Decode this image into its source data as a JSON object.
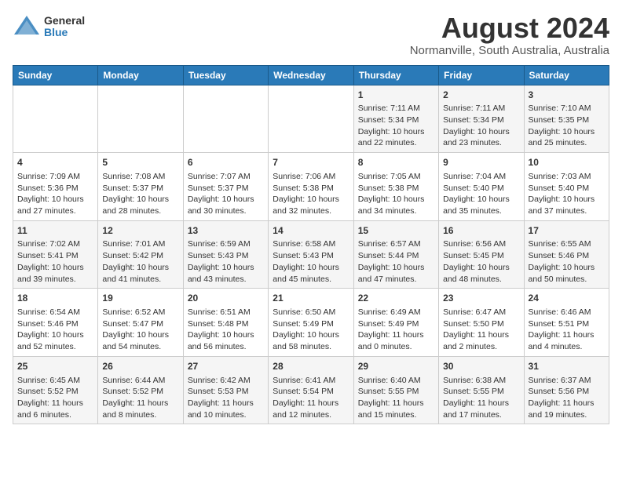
{
  "header": {
    "logo_general": "General",
    "logo_blue": "Blue",
    "month_title": "August 2024",
    "location": "Normanville, South Australia, Australia"
  },
  "days_of_week": [
    "Sunday",
    "Monday",
    "Tuesday",
    "Wednesday",
    "Thursday",
    "Friday",
    "Saturday"
  ],
  "weeks": [
    [
      {
        "day": "",
        "info": ""
      },
      {
        "day": "",
        "info": ""
      },
      {
        "day": "",
        "info": ""
      },
      {
        "day": "",
        "info": ""
      },
      {
        "day": "1",
        "info": "Sunrise: 7:11 AM\nSunset: 5:34 PM\nDaylight: 10 hours\nand 22 minutes."
      },
      {
        "day": "2",
        "info": "Sunrise: 7:11 AM\nSunset: 5:34 PM\nDaylight: 10 hours\nand 23 minutes."
      },
      {
        "day": "3",
        "info": "Sunrise: 7:10 AM\nSunset: 5:35 PM\nDaylight: 10 hours\nand 25 minutes."
      }
    ],
    [
      {
        "day": "4",
        "info": "Sunrise: 7:09 AM\nSunset: 5:36 PM\nDaylight: 10 hours\nand 27 minutes."
      },
      {
        "day": "5",
        "info": "Sunrise: 7:08 AM\nSunset: 5:37 PM\nDaylight: 10 hours\nand 28 minutes."
      },
      {
        "day": "6",
        "info": "Sunrise: 7:07 AM\nSunset: 5:37 PM\nDaylight: 10 hours\nand 30 minutes."
      },
      {
        "day": "7",
        "info": "Sunrise: 7:06 AM\nSunset: 5:38 PM\nDaylight: 10 hours\nand 32 minutes."
      },
      {
        "day": "8",
        "info": "Sunrise: 7:05 AM\nSunset: 5:38 PM\nDaylight: 10 hours\nand 34 minutes."
      },
      {
        "day": "9",
        "info": "Sunrise: 7:04 AM\nSunset: 5:40 PM\nDaylight: 10 hours\nand 35 minutes."
      },
      {
        "day": "10",
        "info": "Sunrise: 7:03 AM\nSunset: 5:40 PM\nDaylight: 10 hours\nand 37 minutes."
      }
    ],
    [
      {
        "day": "11",
        "info": "Sunrise: 7:02 AM\nSunset: 5:41 PM\nDaylight: 10 hours\nand 39 minutes."
      },
      {
        "day": "12",
        "info": "Sunrise: 7:01 AM\nSunset: 5:42 PM\nDaylight: 10 hours\nand 41 minutes."
      },
      {
        "day": "13",
        "info": "Sunrise: 6:59 AM\nSunset: 5:43 PM\nDaylight: 10 hours\nand 43 minutes."
      },
      {
        "day": "14",
        "info": "Sunrise: 6:58 AM\nSunset: 5:43 PM\nDaylight: 10 hours\nand 45 minutes."
      },
      {
        "day": "15",
        "info": "Sunrise: 6:57 AM\nSunset: 5:44 PM\nDaylight: 10 hours\nand 47 minutes."
      },
      {
        "day": "16",
        "info": "Sunrise: 6:56 AM\nSunset: 5:45 PM\nDaylight: 10 hours\nand 48 minutes."
      },
      {
        "day": "17",
        "info": "Sunrise: 6:55 AM\nSunset: 5:46 PM\nDaylight: 10 hours\nand 50 minutes."
      }
    ],
    [
      {
        "day": "18",
        "info": "Sunrise: 6:54 AM\nSunset: 5:46 PM\nDaylight: 10 hours\nand 52 minutes."
      },
      {
        "day": "19",
        "info": "Sunrise: 6:52 AM\nSunset: 5:47 PM\nDaylight: 10 hours\nand 54 minutes."
      },
      {
        "day": "20",
        "info": "Sunrise: 6:51 AM\nSunset: 5:48 PM\nDaylight: 10 hours\nand 56 minutes."
      },
      {
        "day": "21",
        "info": "Sunrise: 6:50 AM\nSunset: 5:49 PM\nDaylight: 10 hours\nand 58 minutes."
      },
      {
        "day": "22",
        "info": "Sunrise: 6:49 AM\nSunset: 5:49 PM\nDaylight: 11 hours\nand 0 minutes."
      },
      {
        "day": "23",
        "info": "Sunrise: 6:47 AM\nSunset: 5:50 PM\nDaylight: 11 hours\nand 2 minutes."
      },
      {
        "day": "24",
        "info": "Sunrise: 6:46 AM\nSunset: 5:51 PM\nDaylight: 11 hours\nand 4 minutes."
      }
    ],
    [
      {
        "day": "25",
        "info": "Sunrise: 6:45 AM\nSunset: 5:52 PM\nDaylight: 11 hours\nand 6 minutes."
      },
      {
        "day": "26",
        "info": "Sunrise: 6:44 AM\nSunset: 5:52 PM\nDaylight: 11 hours\nand 8 minutes."
      },
      {
        "day": "27",
        "info": "Sunrise: 6:42 AM\nSunset: 5:53 PM\nDaylight: 11 hours\nand 10 minutes."
      },
      {
        "day": "28",
        "info": "Sunrise: 6:41 AM\nSunset: 5:54 PM\nDaylight: 11 hours\nand 12 minutes."
      },
      {
        "day": "29",
        "info": "Sunrise: 6:40 AM\nSunset: 5:55 PM\nDaylight: 11 hours\nand 15 minutes."
      },
      {
        "day": "30",
        "info": "Sunrise: 6:38 AM\nSunset: 5:55 PM\nDaylight: 11 hours\nand 17 minutes."
      },
      {
        "day": "31",
        "info": "Sunrise: 6:37 AM\nSunset: 5:56 PM\nDaylight: 11 hours\nand 19 minutes."
      }
    ]
  ]
}
